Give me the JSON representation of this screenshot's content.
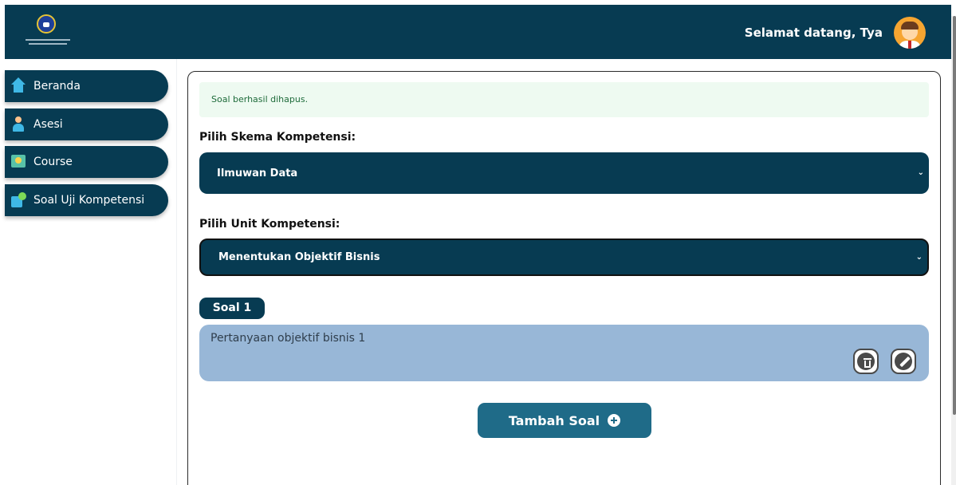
{
  "header": {
    "welcome_text": "Selamat datang, Tya",
    "logo_icon": "institution-logo-icon",
    "avatar_icon": "user-avatar-icon",
    "color": "#073b52"
  },
  "sidebar": {
    "items": [
      {
        "label": "Beranda",
        "icon": "home-icon"
      },
      {
        "label": "Asesi",
        "icon": "user-icon"
      },
      {
        "label": "Course",
        "icon": "course-icon"
      },
      {
        "label": "Soal Uji Kompetensi",
        "icon": "question-bank-icon"
      }
    ]
  },
  "main": {
    "alert_text": "Soal berhasil dihapus.",
    "skema_label": "Pilih Skema Kompetensi:",
    "skema_selected": "Ilmuwan Data",
    "unit_label": "Pilih Unit Kompetensi:",
    "unit_selected": "Menentukan Objektif Bisnis",
    "soal_badge": "Soal 1",
    "question_text": "Pertanyaan objektif bisnis 1",
    "delete_icon": "trash-icon",
    "edit_icon": "pencil-icon",
    "add_button_label": "Tambah Soal",
    "add_icon": "plus-circle-icon"
  },
  "colors": {
    "primary": "#073b52",
    "question_bg": "#98b7d7",
    "add_button": "#1f6b88",
    "alert_bg": "#eefaf1"
  }
}
